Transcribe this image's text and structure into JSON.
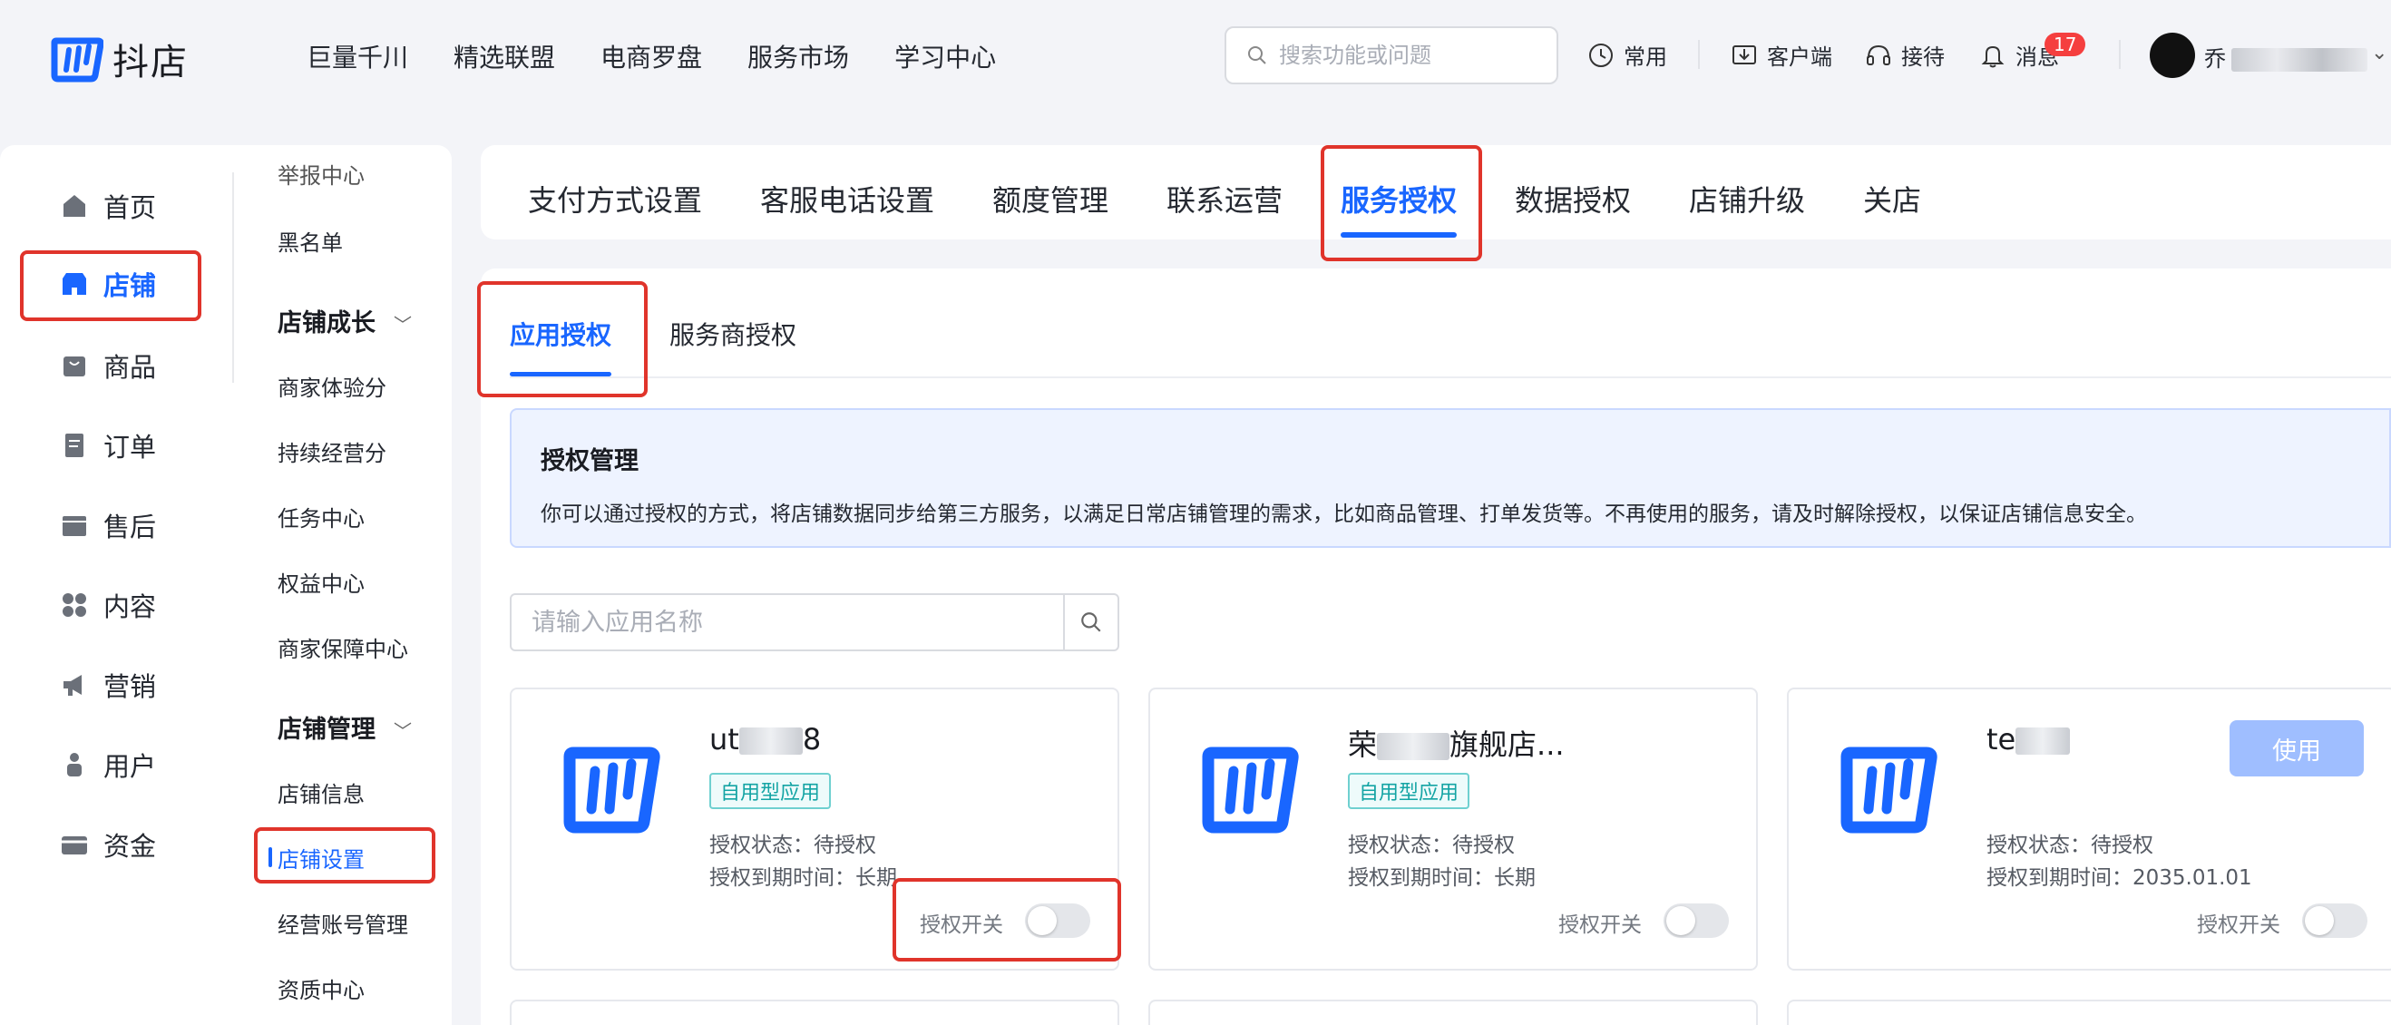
{
  "header": {
    "brand": "抖店",
    "nav": [
      "巨量千川",
      "精选联盟",
      "电商罗盘",
      "服务市场",
      "学习中心"
    ],
    "search_placeholder": "搜索功能或问题",
    "tools": {
      "frequent": "常用",
      "client": "客户端",
      "reception": "接待",
      "messages": "消息",
      "message_count": "17"
    },
    "user_name": "乔"
  },
  "sidebar": {
    "primary": [
      {
        "label": "首页",
        "icon": "home-icon"
      },
      {
        "label": "店铺",
        "icon": "store-icon"
      },
      {
        "label": "商品",
        "icon": "bag-icon"
      },
      {
        "label": "订单",
        "icon": "order-icon"
      },
      {
        "label": "售后",
        "icon": "after-sale-icon"
      },
      {
        "label": "内容",
        "icon": "content-icon"
      },
      {
        "label": "营销",
        "icon": "megaphone-icon"
      },
      {
        "label": "用户",
        "icon": "user-icon"
      },
      {
        "label": "资金",
        "icon": "wallet-icon"
      }
    ],
    "secondary": {
      "cut_item": "举报中心",
      "blacklist": "黑名单",
      "growth_title": "店铺成长",
      "growth_items": [
        "商家体验分",
        "持续经营分",
        "任务中心",
        "权益中心",
        "商家保障中心"
      ],
      "manage_title": "店铺管理",
      "manage_items": [
        "店铺信息",
        "店铺设置",
        "经营账号管理",
        "资质中心"
      ]
    }
  },
  "tabs": [
    "支付方式设置",
    "客服电话设置",
    "额度管理",
    "联系运营",
    "服务授权",
    "数据授权",
    "店铺升级",
    "关店"
  ],
  "subtabs": [
    "应用授权",
    "服务商授权"
  ],
  "notice": {
    "title": "授权管理",
    "desc": "你可以通过授权的方式，将店铺数据同步给第三方服务，以满足日常店铺管理的需求，比如商品管理、打单发货等。不再使用的服务，请及时解除授权，以保证店铺信息安全。"
  },
  "app_search_placeholder": "请输入应用名称",
  "cards": [
    {
      "name_prefix": "ut",
      "name_suffix": "8",
      "tag": "自用型应用",
      "status": "授权状态：待授权",
      "expiry": "授权到期时间：长期",
      "switch_label": "授权开关"
    },
    {
      "name_prefix": "荣",
      "name_suffix": "旗舰店...",
      "tag": "自用型应用",
      "status": "授权状态：待授权",
      "expiry": "授权到期时间：长期",
      "switch_label": "授权开关"
    },
    {
      "name_prefix": "te",
      "name_suffix": "",
      "use_button": "使用",
      "status": "授权状态：待授权",
      "expiry": "授权到期时间：2035.01.01",
      "switch_label": "授权开关"
    }
  ],
  "colors": {
    "brand": "#1966ff",
    "highlight": "#e0342b",
    "tag": "#14a4a4"
  }
}
